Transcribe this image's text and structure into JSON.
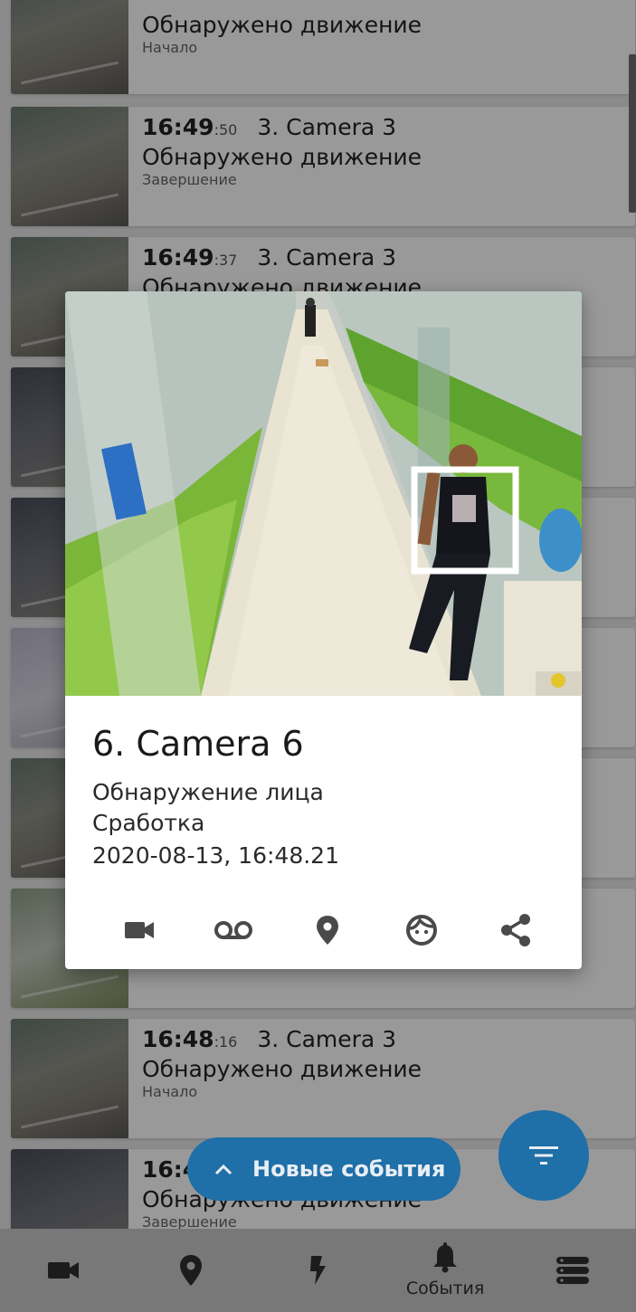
{
  "events": [
    {
      "hm": "",
      "sec": "",
      "camera": "",
      "type": "Обнаружено движение",
      "phase": "Начало",
      "thumb": "parking"
    },
    {
      "hm": "16:49",
      "sec": ":50",
      "camera": "3. Camera 3",
      "type": "Обнаружено движение",
      "phase": "Завершение",
      "thumb": "parking"
    },
    {
      "hm": "16:49",
      "sec": ":37",
      "camera": "3. Camera 3",
      "type": "Обнаружено движение",
      "phase": "",
      "thumb": "parking"
    },
    {
      "hm": "",
      "sec": "",
      "camera": "",
      "type": "",
      "phase": "",
      "thumb": "store"
    },
    {
      "hm": "",
      "sec": "",
      "camera": "",
      "type": "",
      "phase": "",
      "thumb": "store"
    },
    {
      "hm": "",
      "sec": "",
      "camera": "",
      "type": "",
      "phase": "",
      "thumb": "office"
    },
    {
      "hm": "",
      "sec": "",
      "camera": "",
      "type": "",
      "phase": "",
      "thumb": "parking"
    },
    {
      "hm": "",
      "sec": "",
      "camera": "",
      "type": "",
      "phase": "",
      "thumb": "corr"
    },
    {
      "hm": "16:48",
      "sec": ":16",
      "camera": "3. Camera 3",
      "type": "Обнаружено движение",
      "phase": "Начало",
      "thumb": "parking"
    },
    {
      "hm": "16:4",
      "sec": "",
      "camera": "",
      "type": "Обнаружено движение",
      "phase": "Завершение",
      "thumb": "store"
    }
  ],
  "popup": {
    "camera_title": "6. Camera 6",
    "event_type": "Обнаружение лица",
    "phase": "Сработка",
    "datetime": "2020-08-13, 16:48.21",
    "actions": [
      "video-camera-icon",
      "archive-recording-icon",
      "map-pin-icon",
      "face-icon",
      "share-icon"
    ]
  },
  "new_events_button": {
    "label": "Новые события",
    "icon": "chevron-up-icon"
  },
  "filter_button": {
    "icon": "filter-icon"
  },
  "bottom_nav": {
    "items": [
      {
        "icon": "video-camera-icon",
        "label": ""
      },
      {
        "icon": "map-pin-icon",
        "label": ""
      },
      {
        "icon": "lightning-icon",
        "label": ""
      },
      {
        "icon": "bell-icon",
        "label": "События",
        "active": true
      },
      {
        "icon": "servers-icon",
        "label": ""
      }
    ]
  },
  "colors": {
    "accent": "#1f6fa8",
    "nav_bg": "#c9c9c9",
    "icon": "#303030",
    "popup_icon": "#4a4a4a"
  }
}
